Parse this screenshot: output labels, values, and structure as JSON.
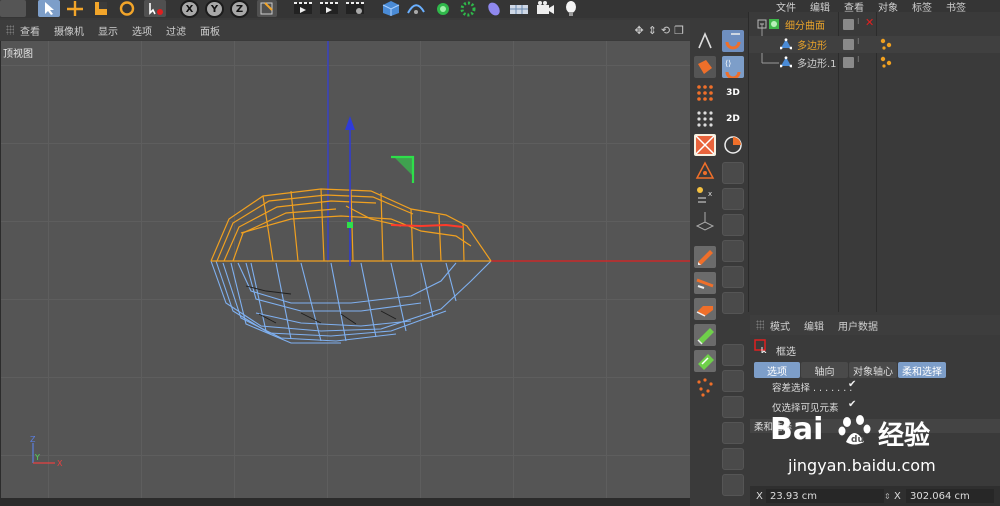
{
  "toolbar": {
    "axis_buttons": [
      "X",
      "Y",
      "Z"
    ]
  },
  "viewport": {
    "menu": [
      "查看",
      "摄像机",
      "显示",
      "选项",
      "过滤",
      "面板"
    ],
    "label": "顶视图",
    "mini_axes": {
      "x": "X",
      "y": "Y",
      "z": "Z"
    }
  },
  "tools": {
    "mode_3d": "3D",
    "mode_2d": "2D"
  },
  "objects": {
    "menu": [
      "文件",
      "编辑",
      "查看",
      "对象",
      "标签",
      "书签"
    ],
    "items": [
      {
        "name": "细分曲面",
        "color": "#e8a22a"
      },
      {
        "name": "多边形",
        "color": "#e8a22a"
      },
      {
        "name": "多边形.1",
        "color": "#cfcfcf"
      }
    ]
  },
  "attributes": {
    "menu": [
      "模式",
      "编辑",
      "用户数据"
    ],
    "tool_name": "框选",
    "tabs": [
      "选项",
      "轴向",
      "对象轴心",
      "柔和选择"
    ],
    "active_tabs": [
      "选项",
      "柔和选择"
    ],
    "options": [
      {
        "label": "容差选择 . . . . . . .",
        "check": "✔"
      },
      {
        "label": "仅选择可见元素",
        "check": "✔"
      }
    ],
    "section": "柔和选择"
  },
  "coords": {
    "x_label": "X",
    "x_value": "23.93 cm",
    "x2_label": "X",
    "x2_value": "302.064 cm"
  },
  "watermark": {
    "brand_a": "Bai",
    "brand_b": "经验",
    "url": "jingyan.baidu.com"
  },
  "colors": {
    "accent": "#e8a22a",
    "selected": "#7d9ec9",
    "axis_x": "#e02020",
    "axis_y": "#2f3bd8",
    "mesh_orange": "#f0a020",
    "mesh_blue": "#7fb0f0"
  }
}
